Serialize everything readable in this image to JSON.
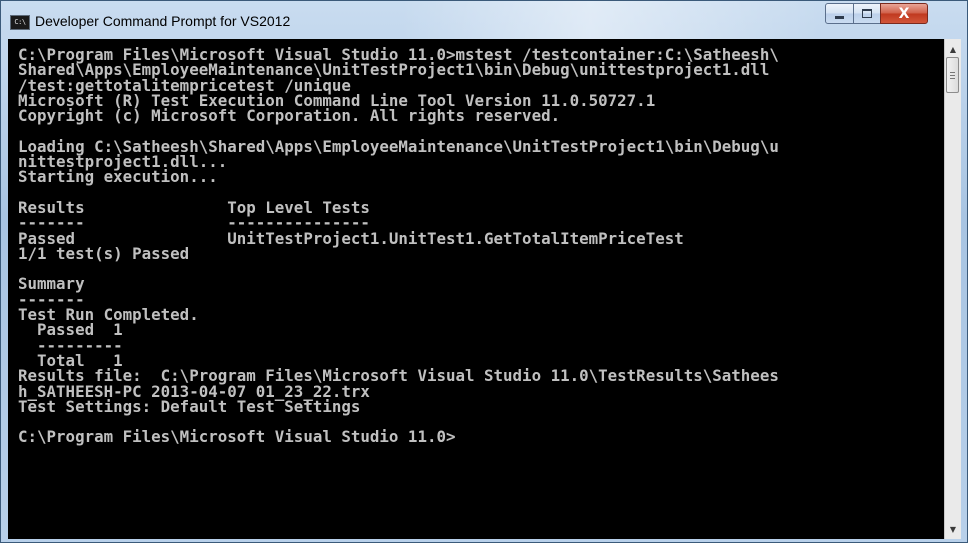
{
  "window": {
    "title": "Developer Command Prompt for VS2012",
    "app_icon_label": "C:\\",
    "controls": {
      "minimize_icon": "minimize-icon",
      "maximize_icon": "maximize-icon",
      "close_icon": "close-icon",
      "close_glyph": "X"
    }
  },
  "console": {
    "background": "#000000",
    "text_color": "#c0c0c0",
    "lines": [
      "C:\\Program Files\\Microsoft Visual Studio 11.0>mstest /testcontainer:C:\\Satheesh\\",
      "Shared\\Apps\\EmployeeMaintenance\\UnitTestProject1\\bin\\Debug\\unittestproject1.dll",
      "/test:gettotalitempricetest /unique",
      "Microsoft (R) Test Execution Command Line Tool Version 11.0.50727.1",
      "Copyright (c) Microsoft Corporation. All rights reserved.",
      "",
      "Loading C:\\Satheesh\\Shared\\Apps\\EmployeeMaintenance\\UnitTestProject1\\bin\\Debug\\u",
      "nittestproject1.dll...",
      "Starting execution...",
      "",
      "Results               Top Level Tests",
      "-------               ---------------",
      "Passed                UnitTestProject1.UnitTest1.GetTotalItemPriceTest",
      "1/1 test(s) Passed",
      "",
      "Summary",
      "-------",
      "Test Run Completed.",
      "  Passed  1",
      "  ---------",
      "  Total   1",
      "Results file:  C:\\Program Files\\Microsoft Visual Studio 11.0\\TestResults\\Sathees",
      "h_SATHEESH-PC 2013-04-07 01_23_22.trx",
      "Test Settings: Default Test Settings",
      "",
      "C:\\Program Files\\Microsoft Visual Studio 11.0>"
    ]
  },
  "scrollbar": {
    "up_arrow": "▲",
    "down_arrow": "▼"
  }
}
